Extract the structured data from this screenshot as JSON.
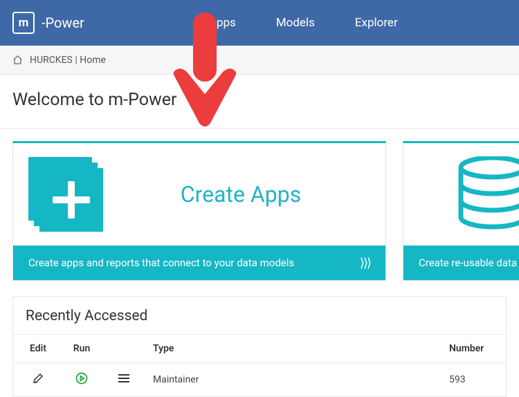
{
  "brand": {
    "badge": "m",
    "name": "-Power"
  },
  "nav": {
    "apps": "Apps",
    "models": "Models",
    "explorer": "Explorer"
  },
  "breadcrumb": {
    "text": "HURCKES | Home"
  },
  "welcome_heading": "Welcome to m-Power",
  "cards": {
    "create_apps": {
      "title": "Create Apps",
      "footer_text": "Create apps and reports that connect to your data models"
    },
    "data_models": {
      "footer_text": "Create re-usable data se"
    }
  },
  "recent": {
    "title": "Recently Accessed",
    "headers": {
      "edit": "Edit",
      "run": "Run",
      "menu": "",
      "type": "Type",
      "number": "Number"
    },
    "rows": [
      {
        "type": "Maintainer",
        "number": "593"
      }
    ]
  }
}
